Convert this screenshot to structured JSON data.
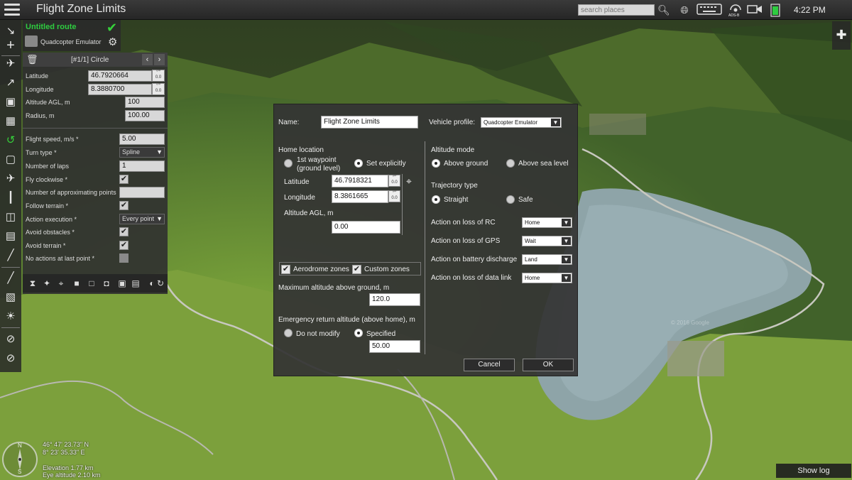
{
  "app": {
    "title": "Flight Zone Limits"
  },
  "topbar": {
    "search_placeholder": "search places",
    "adsb_label": "ADS-B",
    "clock": "4:22 PM"
  },
  "route": {
    "name": "Untitled route",
    "vehicle": "Quadcopter Emulator"
  },
  "waypoint_panel": {
    "title": "[#1/1] Circle",
    "fields": [
      {
        "label": "Latitude",
        "value": "46.7920664"
      },
      {
        "label": "Longitude",
        "value": "8.3880700"
      },
      {
        "label": "Altitude AGL, m",
        "value": "100"
      },
      {
        "label": "Radius, m",
        "value": "100.00"
      }
    ],
    "params": {
      "flight_speed": {
        "label": "Flight speed, m/s *",
        "value": "5.00"
      },
      "turn_type": {
        "label": "Turn type *",
        "value": "Spline"
      },
      "laps": {
        "label": "Number of laps",
        "value": "1"
      },
      "clockwise": {
        "label": "Fly clockwise *",
        "checked": true
      },
      "approx_points": {
        "label": "Number of approximating points",
        "value": ""
      },
      "follow_terrain": {
        "label": "Follow terrain *",
        "checked": true
      },
      "action_execution": {
        "label": "Action execution *",
        "value": "Every point"
      },
      "avoid_obstacles": {
        "label": "Avoid obstacles *",
        "checked": true
      },
      "avoid_terrain": {
        "label": "Avoid terrain *",
        "checked": true
      },
      "no_actions_last": {
        "label": "No actions at last point *",
        "checked": false
      }
    }
  },
  "dialog": {
    "name_label": "Name:",
    "name_value": "Flight Zone Limits",
    "vehicle_profile_label": "Vehicle profile:",
    "vehicle_profile_value": "Quadcopter Emulator",
    "home_location_label": "Home location",
    "home_opt1": "1st waypoint\n(ground level)",
    "home_opt1_line1": "1st waypoint",
    "home_opt1_line2": "(ground level)",
    "home_opt2": "Set explicitly",
    "latitude_label": "Latitude",
    "latitude_value": "46.7918321",
    "longitude_label": "Longitude",
    "longitude_value": "8.3861665",
    "alt_agl_label": "Altitude AGL, m",
    "alt_agl_value": "0.00",
    "aerodrome_label": "Aerodrome zones",
    "custom_label": "Custom zones",
    "max_alt_label": "Maximum altitude above ground, m",
    "max_alt_value": "120.0",
    "emergency_label": "Emergency return altitude (above home), m",
    "emerg_opt1": "Do not modify",
    "emerg_opt2": "Specified",
    "emerg_value": "50.00",
    "altitude_mode_label": "Altitude mode",
    "alt_opt1": "Above ground",
    "alt_opt2": "Above sea level",
    "trajectory_label": "Trajectory type",
    "traj_opt1": "Straight",
    "traj_opt2": "Safe",
    "actions": [
      {
        "label": "Action on loss of RC",
        "value": "Home"
      },
      {
        "label": "Action on loss of GPS",
        "value": "Wait"
      },
      {
        "label": "Action on battery discharge",
        "value": "Land"
      },
      {
        "label": "Action on loss of data link",
        "value": "Home"
      }
    ],
    "cancel_label": "Cancel",
    "ok_label": "OK"
  },
  "bottom": {
    "lat": "46° 47' 23.73\" N",
    "lon": "8° 23' 35.33\" E",
    "elevation": "Elevation 1.77 km",
    "eye_altitude": "Eye altitude 2.10 km",
    "compass_n": "N",
    "compass_s": "S",
    "show_log": "Show log",
    "watermark": "© 2016 Google"
  }
}
